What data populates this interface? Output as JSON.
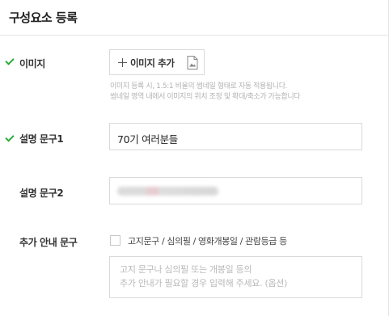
{
  "header": {
    "title": "구성요소 등록"
  },
  "fields": {
    "image": {
      "label": "이미지",
      "button_label": "이미지 추가",
      "help_line1": "이미지 등록 시, 1.5:1 비율의 썸네일 형태로 자동 적용됩니다.",
      "help_line2": "썸네일 영역 내에서 이미지의 위치 조정 및 확대/축소가 가능합니다"
    },
    "desc1": {
      "label": "설명 문구1",
      "value": "70기 여러분들"
    },
    "desc2": {
      "label": "설명 문구2"
    },
    "extra": {
      "label": "추가 안내 문구",
      "checkbox_label": "고지문구 / 심의필 / 영화개봉일 / 관람등급 등",
      "placeholder_line1": "고지 문구나 심의필 또는 개봉일 등의",
      "placeholder_line2": "추가 안내가 필요할 경우 입력해 주세요. (옵션)"
    }
  },
  "colors": {
    "check": "#2eaa3c",
    "border": "#d9d9d9",
    "help_text": "#b3b3b3"
  },
  "icons": {
    "check": "check-icon",
    "plus": "plus-icon",
    "file": "image-file-icon"
  }
}
